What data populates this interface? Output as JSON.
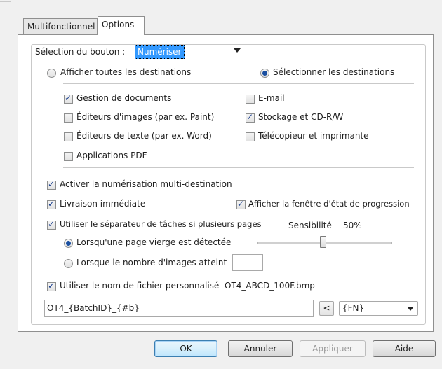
{
  "tabs": [
    {
      "label": "Multifonctionnel",
      "active": false
    },
    {
      "label": "Options",
      "active": true
    }
  ],
  "button_selection": {
    "label": "Sélection du bouton :",
    "value": "Numériser"
  },
  "destinations_mode": {
    "show_all_label": "Afficher toutes les destinations",
    "show_all_selected": false,
    "select_label": "Sélectionner les destinations",
    "select_selected": true
  },
  "destinations": [
    {
      "label": "Gestion de documents",
      "checked": true
    },
    {
      "label": "E-mail",
      "checked": false
    },
    {
      "label": "Éditeurs d'images (par ex. Paint)",
      "checked": false
    },
    {
      "label": "Stockage et CD-R/W",
      "checked": true
    },
    {
      "label": "Éditeurs de texte (par ex. Word)",
      "checked": false
    },
    {
      "label": "Télécopieur et imprimante",
      "checked": false
    },
    {
      "label": "Applications PDF",
      "checked": false
    }
  ],
  "options": {
    "multi_destination": {
      "label": "Activer la numérisation multi-destination",
      "checked": true
    },
    "instant_delivery": {
      "label": "Livraison immédiate",
      "checked": true
    },
    "progress_window": {
      "label": "Afficher la fenêtre d'état de progression",
      "checked": true
    },
    "job_separator": {
      "label": "Utiliser le séparateur de tâches si plusieurs pages",
      "checked": true
    },
    "sensitivity_label": "Sensibilité",
    "sensitivity_value": "50%",
    "sensitivity_fraction": 0.5,
    "blank_page": {
      "label": "Lorsqu'une page vierge est détectée",
      "selected": true
    },
    "image_count": {
      "label": "Lorsque le nombre d'images atteint",
      "selected": false,
      "value": ""
    },
    "custom_filename": {
      "label": "Utiliser le nom de fichier personnalisé",
      "checked": true,
      "example": "OT4_ABCD_100F.bmp"
    },
    "filename_pattern": "OT4_{BatchID}_{#b}",
    "insert_button_label": "<",
    "token_select_value": "{FN}"
  },
  "buttons": {
    "ok": "OK",
    "cancel": "Annuler",
    "apply": "Appliquer",
    "help": "Aide"
  }
}
